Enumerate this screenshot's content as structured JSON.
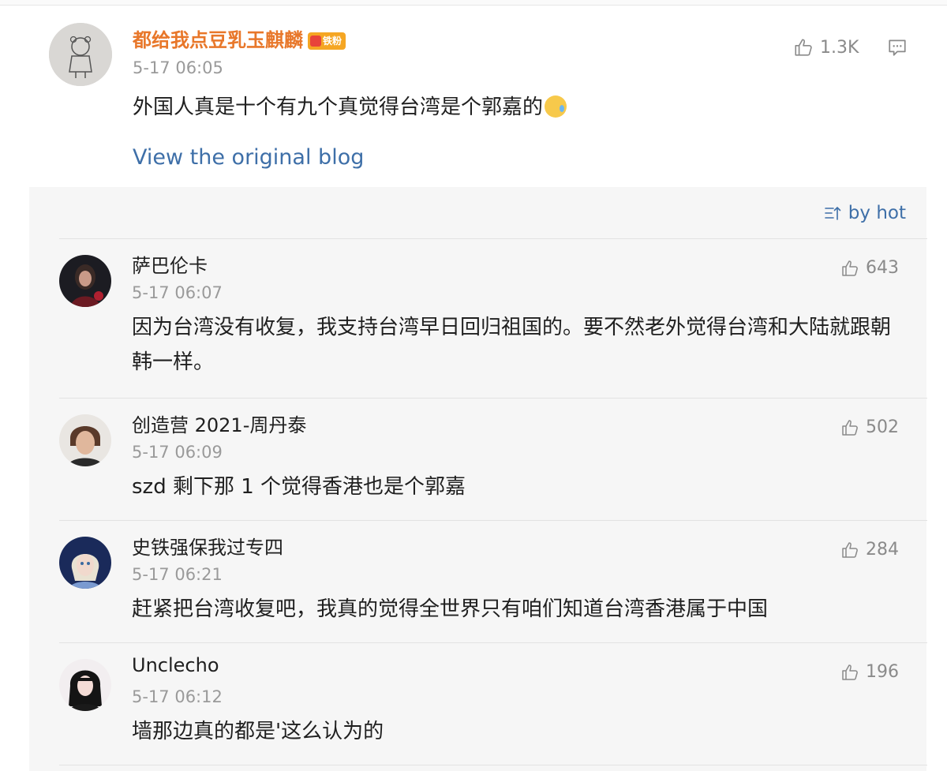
{
  "post": {
    "author": "都给我点豆乳玉麒麟",
    "badge": "铁粉",
    "time": "5-17 06:05",
    "text": "外国人真是十个有九个真觉得台湾是个郭嘉的",
    "likes": "1.3K",
    "view_original": "View the original blog"
  },
  "sort_label": "by hot",
  "comments": [
    {
      "author": "萨巴伦卡",
      "time": "5-17 06:07",
      "text": "因为台湾没有收复，我支持台湾早日回归祖国的。要不然老外觉得台湾和大陆就跟朝韩一样。",
      "likes": "643"
    },
    {
      "author": "创造营 2021-周丹泰",
      "time": "5-17 06:09",
      "text": "szd 剩下那 1 个觉得香港也是个郭嘉",
      "likes": "502"
    },
    {
      "author": "史铁强保我过专四",
      "time": "5-17 06:21",
      "text": "赶紧把台湾收复吧，我真的觉得全世界只有咱们知道台湾香港属于中国",
      "likes": "284"
    },
    {
      "author": "Unclecho",
      "time": "5-17 06:12",
      "text": "墙那边真的都是'这么认为的",
      "likes": "196"
    }
  ],
  "colors": {
    "author_accent": "#e8772a",
    "link": "#3e6fa8",
    "muted": "#9a9a9a",
    "panel_bg": "#f6f6f6"
  },
  "icons": [
    "thumbs-up-icon",
    "comment-icon",
    "sort-icon",
    "emoji-sweat-icon",
    "fan-badge-icon"
  ]
}
